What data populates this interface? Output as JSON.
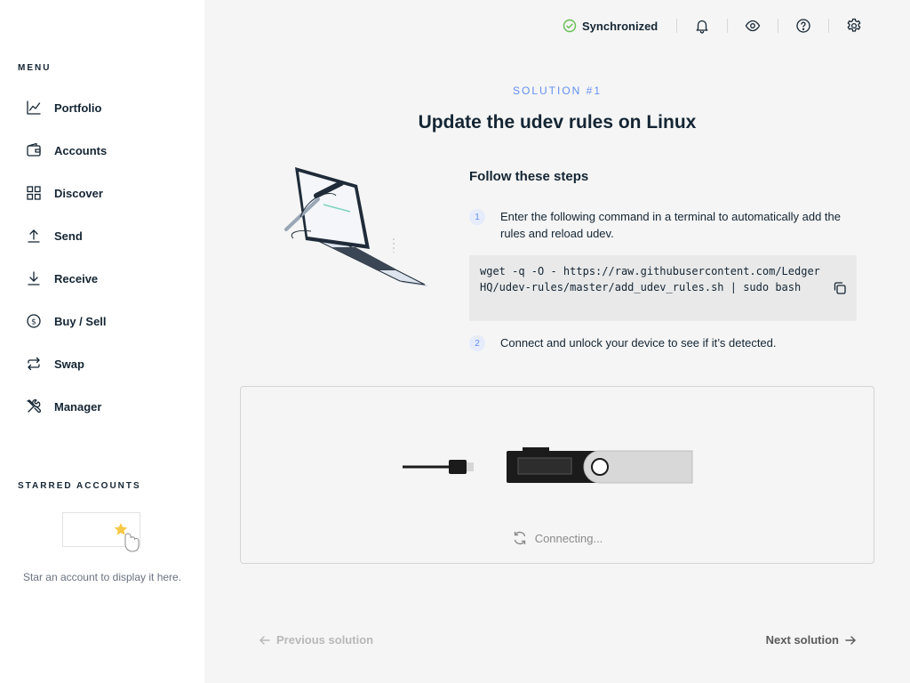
{
  "sidebar": {
    "menu_title": "MENU",
    "items": [
      {
        "label": "Portfolio",
        "icon": "chart-icon"
      },
      {
        "label": "Accounts",
        "icon": "wallet-icon"
      },
      {
        "label": "Discover",
        "icon": "grid-icon"
      },
      {
        "label": "Send",
        "icon": "send-icon"
      },
      {
        "label": "Receive",
        "icon": "receive-icon"
      },
      {
        "label": "Buy / Sell",
        "icon": "dollar-icon"
      },
      {
        "label": "Swap",
        "icon": "swap-icon"
      },
      {
        "label": "Manager",
        "icon": "tools-icon"
      }
    ],
    "starred_title": "STARRED ACCOUNTS",
    "starred_empty": "Star an account to display it here."
  },
  "topbar": {
    "sync_label": "Synchronized",
    "icons": [
      "bell-icon",
      "eye-icon",
      "help-icon",
      "settings-icon"
    ]
  },
  "main": {
    "eyebrow": "SOLUTION #1",
    "title": "Update the udev rules on Linux",
    "steps_title": "Follow these steps",
    "steps": [
      {
        "number": "1",
        "text": "Enter the following command in a terminal to automatically add the rules and reload udev."
      },
      {
        "number": "2",
        "text": "Connect and unlock your device to see if it’s detected."
      }
    ],
    "command": "wget -q -O - https://raw.githubusercontent.com/LedgerHQ/udev-rules/master/add_udev_rules.sh | sudo bash",
    "connecting": "Connecting...",
    "prev_label": "Previous solution",
    "next_label": "Next solution"
  },
  "colors": {
    "accent": "#6490f1",
    "success": "#66be54",
    "text": "#142533",
    "sidebar_bg": "#ffffff",
    "main_bg": "#f5f5f5"
  }
}
